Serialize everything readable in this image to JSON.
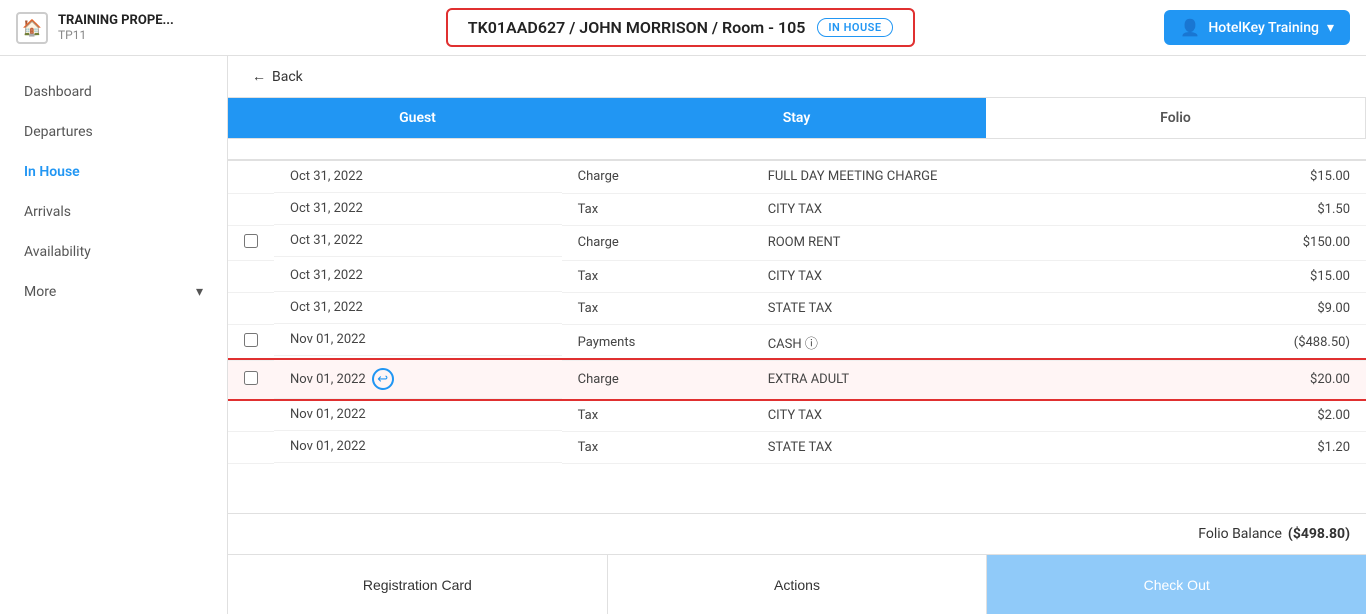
{
  "header": {
    "brand_name": "TRAINING PROPE...",
    "brand_id": "TP11",
    "booking_id": "TK01AAD627 / JOHN MORRISON / Room - 105",
    "in_house_label": "IN HOUSE",
    "user_label": "HotelKey Training",
    "user_chevron": "▾"
  },
  "sidebar": {
    "items": [
      {
        "id": "dashboard",
        "label": "Dashboard"
      },
      {
        "id": "departures",
        "label": "Departures"
      },
      {
        "id": "inhouse",
        "label": "In House",
        "active": true
      },
      {
        "id": "arrivals",
        "label": "Arrivals"
      },
      {
        "id": "availability",
        "label": "Availability"
      },
      {
        "id": "more",
        "label": "More"
      }
    ]
  },
  "back_button": "← Back",
  "tabs": [
    {
      "id": "guest",
      "label": "Guest",
      "active": true
    },
    {
      "id": "stay",
      "label": "Stay",
      "active": true
    },
    {
      "id": "folio",
      "label": "Folio"
    }
  ],
  "folio_rows": [
    {
      "id": 1,
      "has_checkbox": false,
      "date": "Oct 31, 2022",
      "type": "Charge",
      "description": "FULL DAY MEETING CHARGE",
      "amount": "$15.00",
      "highlight": false,
      "has_undo": false
    },
    {
      "id": 2,
      "has_checkbox": false,
      "date": "Oct 31, 2022",
      "type": "Tax",
      "description": "CITY TAX",
      "amount": "$1.50",
      "highlight": false,
      "has_undo": false
    },
    {
      "id": 3,
      "has_checkbox": true,
      "date": "Oct 31, 2022",
      "type": "Charge",
      "description": "ROOM RENT",
      "amount": "$150.00",
      "highlight": false,
      "has_undo": false
    },
    {
      "id": 4,
      "has_checkbox": false,
      "date": "Oct 31, 2022",
      "type": "Tax",
      "description": "CITY TAX",
      "amount": "$15.00",
      "highlight": false,
      "has_undo": false
    },
    {
      "id": 5,
      "has_checkbox": false,
      "date": "Oct 31, 2022",
      "type": "Tax",
      "description": "STATE TAX",
      "amount": "$9.00",
      "highlight": false,
      "has_undo": false
    },
    {
      "id": 6,
      "has_checkbox": true,
      "date": "Nov 01, 2022",
      "type": "Payments",
      "description": "CASH ⓘ",
      "amount": "($488.50)",
      "highlight": false,
      "has_undo": false,
      "negative": true
    },
    {
      "id": 7,
      "has_checkbox": true,
      "date": "Nov 01, 2022",
      "type": "Charge",
      "description": "EXTRA ADULT",
      "amount": "$20.00",
      "highlight": true,
      "has_undo": true
    },
    {
      "id": 8,
      "has_checkbox": false,
      "date": "Nov 01, 2022",
      "type": "Tax",
      "description": "CITY TAX",
      "amount": "$2.00",
      "highlight": false,
      "has_undo": false
    },
    {
      "id": 9,
      "has_checkbox": false,
      "date": "Nov 01, 2022",
      "type": "Tax",
      "description": "STATE TAX",
      "amount": "$1.20",
      "highlight": false,
      "has_undo": false
    }
  ],
  "folio_balance_label": "Folio Balance",
  "folio_balance_amount": "($498.80)",
  "bottom_buttons": [
    {
      "id": "registration-card",
      "label": "Registration Card"
    },
    {
      "id": "actions",
      "label": "Actions"
    },
    {
      "id": "checkout",
      "label": "Check Out"
    }
  ]
}
